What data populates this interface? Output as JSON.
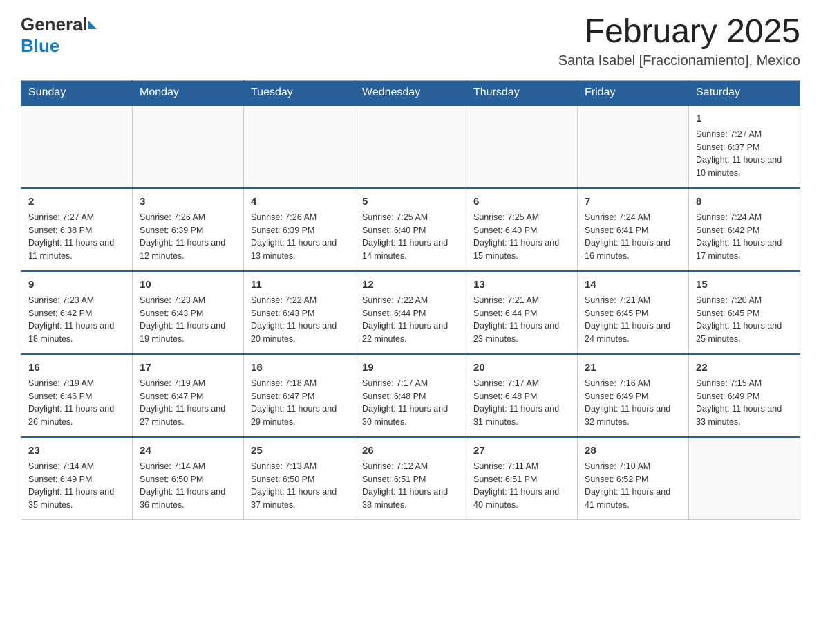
{
  "header": {
    "logo_general": "General",
    "logo_blue": "Blue",
    "month_title": "February 2025",
    "location": "Santa Isabel [Fraccionamiento], Mexico"
  },
  "weekdays": [
    "Sunday",
    "Monday",
    "Tuesday",
    "Wednesday",
    "Thursday",
    "Friday",
    "Saturday"
  ],
  "weeks": [
    [
      {
        "day": "",
        "info": ""
      },
      {
        "day": "",
        "info": ""
      },
      {
        "day": "",
        "info": ""
      },
      {
        "day": "",
        "info": ""
      },
      {
        "day": "",
        "info": ""
      },
      {
        "day": "",
        "info": ""
      },
      {
        "day": "1",
        "info": "Sunrise: 7:27 AM\nSunset: 6:37 PM\nDaylight: 11 hours and 10 minutes."
      }
    ],
    [
      {
        "day": "2",
        "info": "Sunrise: 7:27 AM\nSunset: 6:38 PM\nDaylight: 11 hours and 11 minutes."
      },
      {
        "day": "3",
        "info": "Sunrise: 7:26 AM\nSunset: 6:39 PM\nDaylight: 11 hours and 12 minutes."
      },
      {
        "day": "4",
        "info": "Sunrise: 7:26 AM\nSunset: 6:39 PM\nDaylight: 11 hours and 13 minutes."
      },
      {
        "day": "5",
        "info": "Sunrise: 7:25 AM\nSunset: 6:40 PM\nDaylight: 11 hours and 14 minutes."
      },
      {
        "day": "6",
        "info": "Sunrise: 7:25 AM\nSunset: 6:40 PM\nDaylight: 11 hours and 15 minutes."
      },
      {
        "day": "7",
        "info": "Sunrise: 7:24 AM\nSunset: 6:41 PM\nDaylight: 11 hours and 16 minutes."
      },
      {
        "day": "8",
        "info": "Sunrise: 7:24 AM\nSunset: 6:42 PM\nDaylight: 11 hours and 17 minutes."
      }
    ],
    [
      {
        "day": "9",
        "info": "Sunrise: 7:23 AM\nSunset: 6:42 PM\nDaylight: 11 hours and 18 minutes."
      },
      {
        "day": "10",
        "info": "Sunrise: 7:23 AM\nSunset: 6:43 PM\nDaylight: 11 hours and 19 minutes."
      },
      {
        "day": "11",
        "info": "Sunrise: 7:22 AM\nSunset: 6:43 PM\nDaylight: 11 hours and 20 minutes."
      },
      {
        "day": "12",
        "info": "Sunrise: 7:22 AM\nSunset: 6:44 PM\nDaylight: 11 hours and 22 minutes."
      },
      {
        "day": "13",
        "info": "Sunrise: 7:21 AM\nSunset: 6:44 PM\nDaylight: 11 hours and 23 minutes."
      },
      {
        "day": "14",
        "info": "Sunrise: 7:21 AM\nSunset: 6:45 PM\nDaylight: 11 hours and 24 minutes."
      },
      {
        "day": "15",
        "info": "Sunrise: 7:20 AM\nSunset: 6:45 PM\nDaylight: 11 hours and 25 minutes."
      }
    ],
    [
      {
        "day": "16",
        "info": "Sunrise: 7:19 AM\nSunset: 6:46 PM\nDaylight: 11 hours and 26 minutes."
      },
      {
        "day": "17",
        "info": "Sunrise: 7:19 AM\nSunset: 6:47 PM\nDaylight: 11 hours and 27 minutes."
      },
      {
        "day": "18",
        "info": "Sunrise: 7:18 AM\nSunset: 6:47 PM\nDaylight: 11 hours and 29 minutes."
      },
      {
        "day": "19",
        "info": "Sunrise: 7:17 AM\nSunset: 6:48 PM\nDaylight: 11 hours and 30 minutes."
      },
      {
        "day": "20",
        "info": "Sunrise: 7:17 AM\nSunset: 6:48 PM\nDaylight: 11 hours and 31 minutes."
      },
      {
        "day": "21",
        "info": "Sunrise: 7:16 AM\nSunset: 6:49 PM\nDaylight: 11 hours and 32 minutes."
      },
      {
        "day": "22",
        "info": "Sunrise: 7:15 AM\nSunset: 6:49 PM\nDaylight: 11 hours and 33 minutes."
      }
    ],
    [
      {
        "day": "23",
        "info": "Sunrise: 7:14 AM\nSunset: 6:49 PM\nDaylight: 11 hours and 35 minutes."
      },
      {
        "day": "24",
        "info": "Sunrise: 7:14 AM\nSunset: 6:50 PM\nDaylight: 11 hours and 36 minutes."
      },
      {
        "day": "25",
        "info": "Sunrise: 7:13 AM\nSunset: 6:50 PM\nDaylight: 11 hours and 37 minutes."
      },
      {
        "day": "26",
        "info": "Sunrise: 7:12 AM\nSunset: 6:51 PM\nDaylight: 11 hours and 38 minutes."
      },
      {
        "day": "27",
        "info": "Sunrise: 7:11 AM\nSunset: 6:51 PM\nDaylight: 11 hours and 40 minutes."
      },
      {
        "day": "28",
        "info": "Sunrise: 7:10 AM\nSunset: 6:52 PM\nDaylight: 11 hours and 41 minutes."
      },
      {
        "day": "",
        "info": ""
      }
    ]
  ]
}
